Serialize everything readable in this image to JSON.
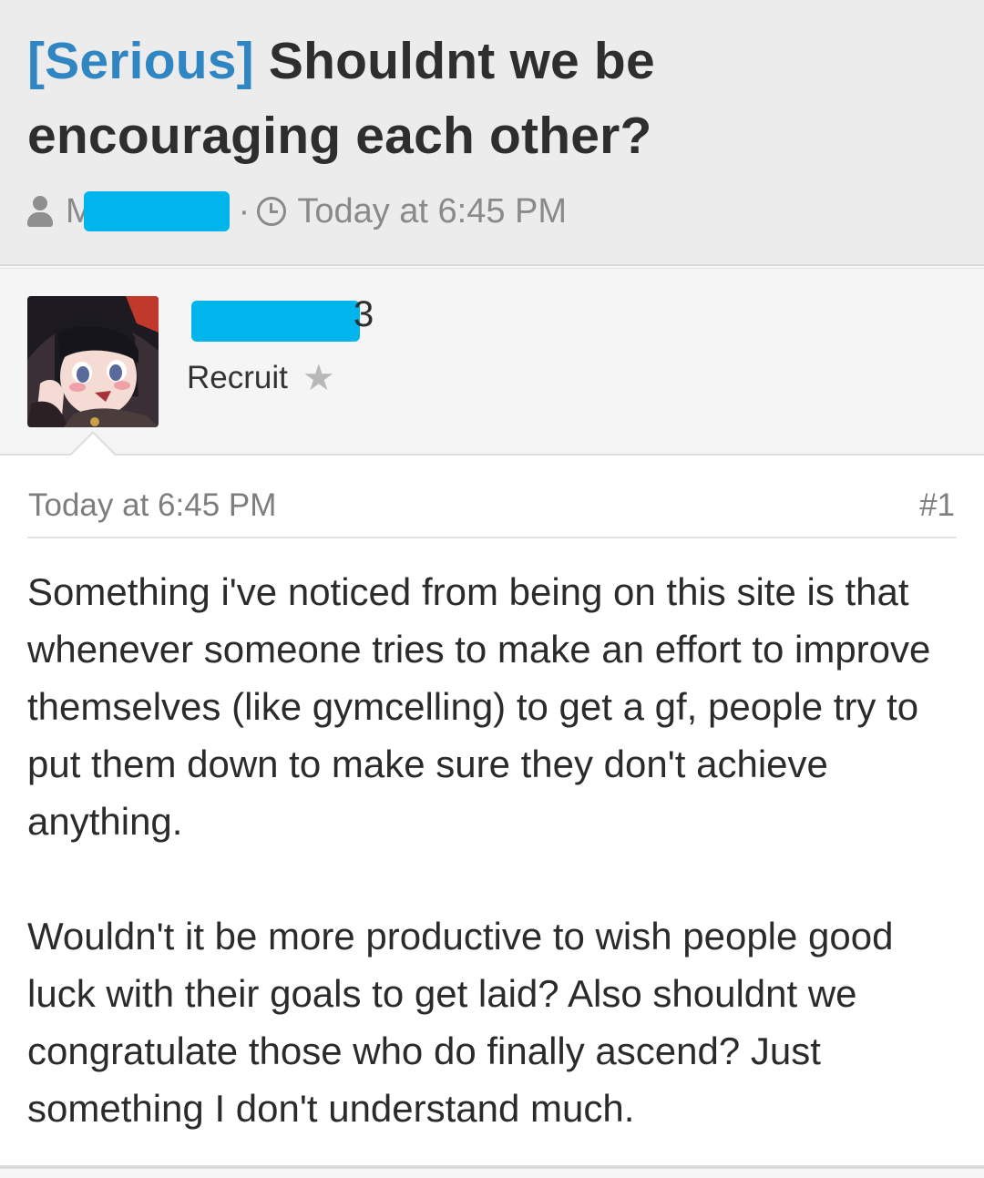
{
  "thread": {
    "prefix": "[Serious]",
    "title": "Shouldnt we be encouraging each other?",
    "starter_initial": "M",
    "time": "Today at 6:45 PM"
  },
  "post": {
    "author_tail": "3",
    "user_title": "Recruit",
    "date": "Today at 6:45 PM",
    "number": "#1",
    "paragraphs": [
      "Something i've noticed from being on this site is that whenever someone tries to make an effort to improve themselves (like gymcelling) to get a gf, people try to put them down to make sure they don't achieve anything.",
      "Wouldn't it be more productive to wish people good luck with their goals to get laid? Also shouldnt we congratulate those who do finally ascend? Just something I don't understand much."
    ]
  },
  "icons": {
    "starter": "user-icon",
    "time": "clock-icon",
    "rank": "star-icon"
  },
  "colors": {
    "prefix": "#2f86c2",
    "redaction": "#00b4ec",
    "header_bg": "#ececec"
  }
}
